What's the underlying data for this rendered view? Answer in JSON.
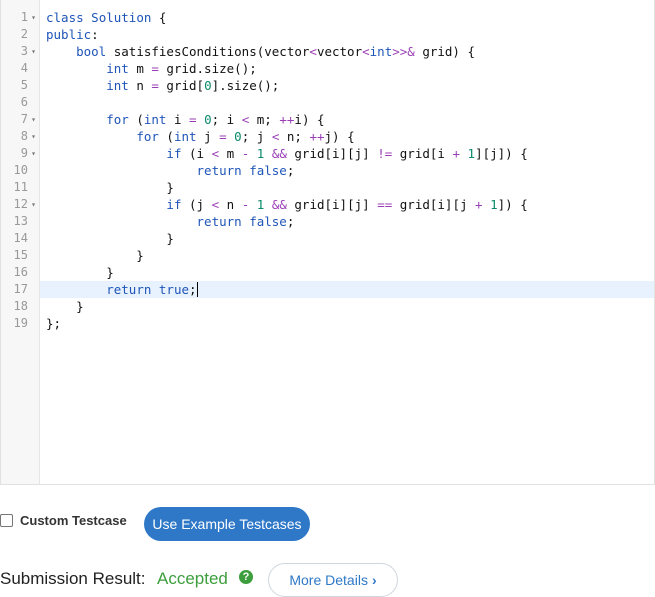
{
  "editor": {
    "lines": [
      {
        "n": "1",
        "fold": true,
        "tokens": [
          [
            "kw",
            "class"
          ],
          [
            "",
            ""
          ],
          [
            "kw",
            " Solution"
          ],
          [
            "",
            " {"
          ]
        ]
      },
      {
        "n": "2",
        "fold": false,
        "tokens": [
          [
            "kw",
            "public"
          ],
          [
            "",
            ":"
          ]
        ]
      },
      {
        "n": "3",
        "fold": true,
        "tokens": [
          [
            "",
            "    "
          ],
          [
            "kw",
            "bool"
          ],
          [
            "",
            " satisfiesConditions(vector"
          ],
          [
            "op",
            "<"
          ],
          [
            "",
            "vector"
          ],
          [
            "op",
            "<"
          ],
          [
            "kw",
            "int"
          ],
          [
            "op",
            ">>&"
          ],
          [
            "",
            " grid) {"
          ]
        ]
      },
      {
        "n": "4",
        "fold": false,
        "tokens": [
          [
            "",
            "        "
          ],
          [
            "kw",
            "int"
          ],
          [
            "",
            " m "
          ],
          [
            "op",
            "="
          ],
          [
            "",
            " grid.size();"
          ]
        ]
      },
      {
        "n": "5",
        "fold": false,
        "tokens": [
          [
            "",
            "        "
          ],
          [
            "kw",
            "int"
          ],
          [
            "",
            " n "
          ],
          [
            "op",
            "="
          ],
          [
            "",
            " grid["
          ],
          [
            "num",
            "0"
          ],
          [
            "",
            "].size();"
          ]
        ]
      },
      {
        "n": "6",
        "fold": false,
        "tokens": []
      },
      {
        "n": "7",
        "fold": true,
        "tokens": [
          [
            "",
            "        "
          ],
          [
            "kw",
            "for"
          ],
          [
            "",
            " ("
          ],
          [
            "kw",
            "int"
          ],
          [
            "",
            " i "
          ],
          [
            "op",
            "="
          ],
          [
            " ",
            ""
          ],
          [
            "num",
            " 0"
          ],
          [
            "",
            "; i "
          ],
          [
            "op",
            "<"
          ],
          [
            "",
            " m; "
          ],
          [
            "op",
            "++"
          ],
          [
            "",
            "i) {"
          ]
        ]
      },
      {
        "n": "8",
        "fold": true,
        "tokens": [
          [
            "",
            "            "
          ],
          [
            "kw",
            "for"
          ],
          [
            "",
            " ("
          ],
          [
            "kw",
            "int"
          ],
          [
            "",
            " j "
          ],
          [
            "op",
            "="
          ],
          [
            "num",
            " 0"
          ],
          [
            "",
            "; j "
          ],
          [
            "op",
            "<"
          ],
          [
            "",
            " n; "
          ],
          [
            "op",
            "++"
          ],
          [
            "",
            "j) {"
          ]
        ]
      },
      {
        "n": "9",
        "fold": true,
        "tokens": [
          [
            "",
            "                "
          ],
          [
            "kw",
            "if"
          ],
          [
            "",
            " (i "
          ],
          [
            "op",
            "<"
          ],
          [
            "",
            " m "
          ],
          [
            "op",
            "-"
          ],
          [
            "num",
            " 1"
          ],
          [
            "op",
            " &&"
          ],
          [
            "",
            " grid[i][j] "
          ],
          [
            "op",
            "!="
          ],
          [
            "",
            " grid[i "
          ],
          [
            "op",
            "+"
          ],
          [
            "num",
            " 1"
          ],
          [
            "",
            "][j]) {"
          ]
        ]
      },
      {
        "n": "10",
        "fold": false,
        "tokens": [
          [
            "",
            "                    "
          ],
          [
            "kw",
            "return"
          ],
          [
            "bool",
            " false"
          ],
          [
            "",
            ";"
          ]
        ]
      },
      {
        "n": "11",
        "fold": false,
        "tokens": [
          [
            "",
            "                }"
          ]
        ]
      },
      {
        "n": "12",
        "fold": true,
        "tokens": [
          [
            "",
            "                "
          ],
          [
            "kw",
            "if"
          ],
          [
            "",
            " (j "
          ],
          [
            "op",
            "<"
          ],
          [
            "",
            " n "
          ],
          [
            "op",
            "-"
          ],
          [
            "num",
            " 1"
          ],
          [
            "op",
            " &&"
          ],
          [
            "",
            " grid[i][j] "
          ],
          [
            "op",
            "=="
          ],
          [
            "",
            " grid[i][j "
          ],
          [
            "op",
            "+"
          ],
          [
            "num",
            " 1"
          ],
          [
            "",
            "]) {"
          ]
        ]
      },
      {
        "n": "13",
        "fold": false,
        "tokens": [
          [
            "",
            "                    "
          ],
          [
            "kw",
            "return"
          ],
          [
            "bool",
            " false"
          ],
          [
            "",
            ";"
          ]
        ]
      },
      {
        "n": "14",
        "fold": false,
        "tokens": [
          [
            "",
            "                }"
          ]
        ]
      },
      {
        "n": "15",
        "fold": false,
        "tokens": [
          [
            "",
            "            }"
          ]
        ]
      },
      {
        "n": "16",
        "fold": false,
        "tokens": [
          [
            "",
            "        }"
          ]
        ]
      },
      {
        "n": "17",
        "fold": false,
        "active": true,
        "tokens": [
          [
            "",
            "        "
          ],
          [
            "kw",
            "return"
          ],
          [
            "bool",
            " true"
          ],
          [
            "",
            ";"
          ]
        ]
      },
      {
        "n": "18",
        "fold": false,
        "tokens": [
          [
            "",
            "    }"
          ]
        ]
      },
      {
        "n": "19",
        "fold": false,
        "tokens": [
          [
            "",
            "};"
          ]
        ]
      }
    ]
  },
  "controls": {
    "custom_testcase_label": "Custom Testcase",
    "use_example_label": "Use Example Testcases"
  },
  "result": {
    "label": "Submission Result:",
    "status": "Accepted",
    "help_icon": "question-circle-icon",
    "details_label": "More Details",
    "details_icon": "chevron-right-icon"
  },
  "colors": {
    "accent": "#2e78c7",
    "success": "#3d9e3d",
    "keyword": "#1f55b8"
  }
}
